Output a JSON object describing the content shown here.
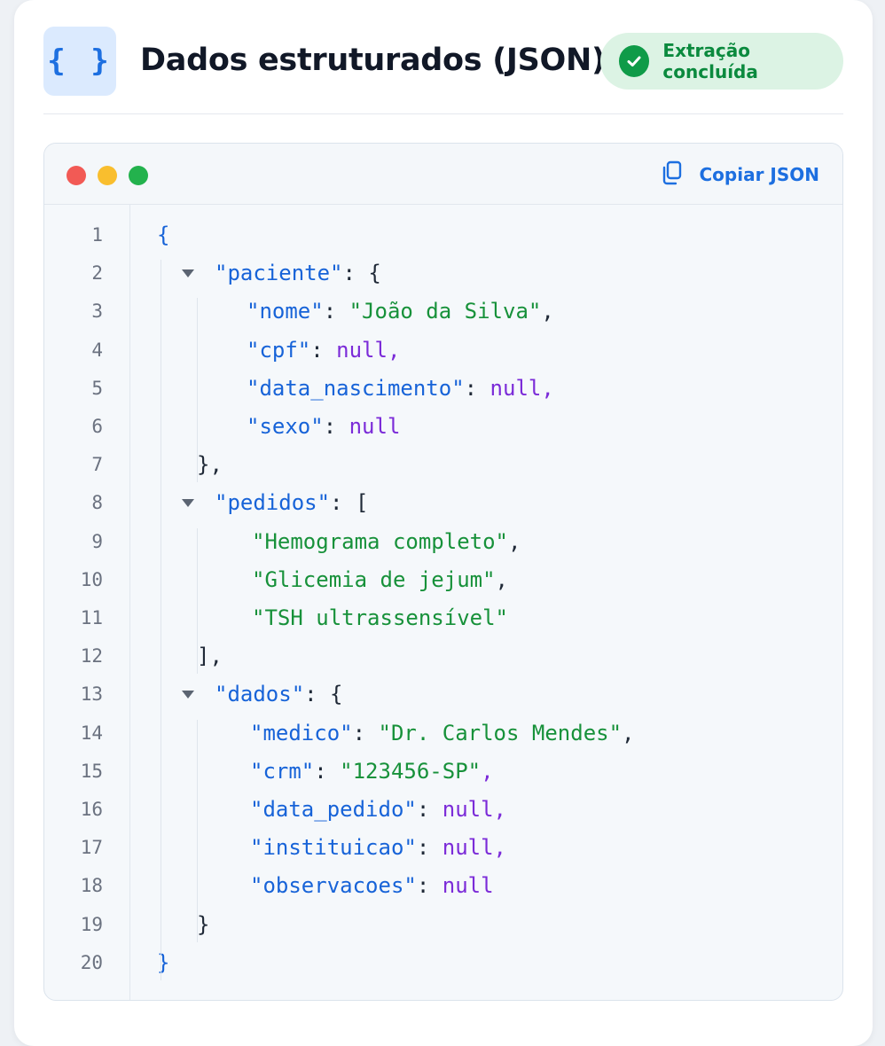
{
  "header": {
    "icon": "braces-icon",
    "icon_glyph": "{ }",
    "title": "Dados estruturados (JSON)",
    "status": {
      "icon": "check-circle-icon",
      "label": "Extração concluída",
      "color": "#0f9b48"
    }
  },
  "editor": {
    "window_controls": [
      "close",
      "minimize",
      "maximize"
    ],
    "copy_button": {
      "icon": "copy-icon",
      "label": "Copiar JSON"
    },
    "line_numbers": [
      "1",
      "2",
      "3",
      "4",
      "5",
      "6",
      "7",
      "8",
      "9",
      "10",
      "11",
      "12",
      "13",
      "14",
      "15",
      "16",
      "17",
      "18",
      "19",
      "20"
    ],
    "lines": [
      {
        "tokens": [
          {
            "t": "k",
            "v": "{"
          }
        ]
      },
      {
        "tokens": [
          {
            "t": "k",
            "v": "\"paciente\""
          },
          {
            "t": "p",
            "v": ": {"
          }
        ]
      },
      {
        "tokens": [
          {
            "t": "k",
            "v": "\"nome\""
          },
          {
            "t": "p",
            "v": ": "
          },
          {
            "t": "s",
            "v": "\"João da Silva\""
          },
          {
            "t": "p",
            "v": ","
          }
        ]
      },
      {
        "tokens": [
          {
            "t": "k",
            "v": "\"cpf\""
          },
          {
            "t": "p",
            "v": ": "
          },
          {
            "t": "n",
            "v": "null"
          },
          {
            "t": "n",
            "v": ","
          }
        ]
      },
      {
        "tokens": [
          {
            "t": "k",
            "v": "\"data_nascimento\""
          },
          {
            "t": "p",
            "v": ": "
          },
          {
            "t": "n",
            "v": "null"
          },
          {
            "t": "n",
            "v": ","
          }
        ]
      },
      {
        "tokens": [
          {
            "t": "k",
            "v": "\"sexo\""
          },
          {
            "t": "p",
            "v": ": "
          },
          {
            "t": "n",
            "v": "null"
          }
        ]
      },
      {
        "tokens": [
          {
            "t": "p",
            "v": "},"
          }
        ]
      },
      {
        "tokens": [
          {
            "t": "k",
            "v": "\"pedidos\""
          },
          {
            "t": "p",
            "v": ": ["
          }
        ]
      },
      {
        "tokens": [
          {
            "t": "s",
            "v": "\"Hemograma completo\""
          },
          {
            "t": "p",
            "v": ","
          }
        ]
      },
      {
        "tokens": [
          {
            "t": "s",
            "v": "\"Glicemia de jejum\""
          },
          {
            "t": "p",
            "v": ","
          }
        ]
      },
      {
        "tokens": [
          {
            "t": "s",
            "v": "\"TSH ultrassensível\""
          }
        ]
      },
      {
        "tokens": [
          {
            "t": "p",
            "v": "],"
          }
        ]
      },
      {
        "tokens": [
          {
            "t": "k",
            "v": "\"dados\""
          },
          {
            "t": "p",
            "v": ": {"
          }
        ]
      },
      {
        "tokens": [
          {
            "t": "k",
            "v": "\"medico\""
          },
          {
            "t": "p",
            "v": ": "
          },
          {
            "t": "s",
            "v": "\"Dr. Carlos Mendes\""
          },
          {
            "t": "p",
            "v": ","
          }
        ]
      },
      {
        "tokens": [
          {
            "t": "k",
            "v": "\"crm\""
          },
          {
            "t": "p",
            "v": ": "
          },
          {
            "t": "s",
            "v": "\"123456-SP\""
          },
          {
            "t": "n",
            "v": ","
          }
        ]
      },
      {
        "tokens": [
          {
            "t": "k",
            "v": "\"data_pedido\""
          },
          {
            "t": "p",
            "v": ": "
          },
          {
            "t": "n",
            "v": "null"
          },
          {
            "t": "n",
            "v": ","
          }
        ]
      },
      {
        "tokens": [
          {
            "t": "k",
            "v": "\"instituicao\""
          },
          {
            "t": "p",
            "v": ": "
          },
          {
            "t": "n",
            "v": "null"
          },
          {
            "t": "n",
            "v": ","
          }
        ]
      },
      {
        "tokens": [
          {
            "t": "k",
            "v": "\"observacoes\""
          },
          {
            "t": "p",
            "v": ": "
          },
          {
            "t": "n",
            "v": "null"
          }
        ]
      },
      {
        "tokens": [
          {
            "t": "p",
            "v": "}"
          }
        ]
      },
      {
        "tokens": [
          {
            "t": "k",
            "v": "}"
          }
        ]
      }
    ]
  },
  "colors": {
    "key": "#1763d8",
    "string": "#17913a",
    "null": "#7b2bd8",
    "punctuation": "#1f2937",
    "accent": "#1d6fe0"
  }
}
